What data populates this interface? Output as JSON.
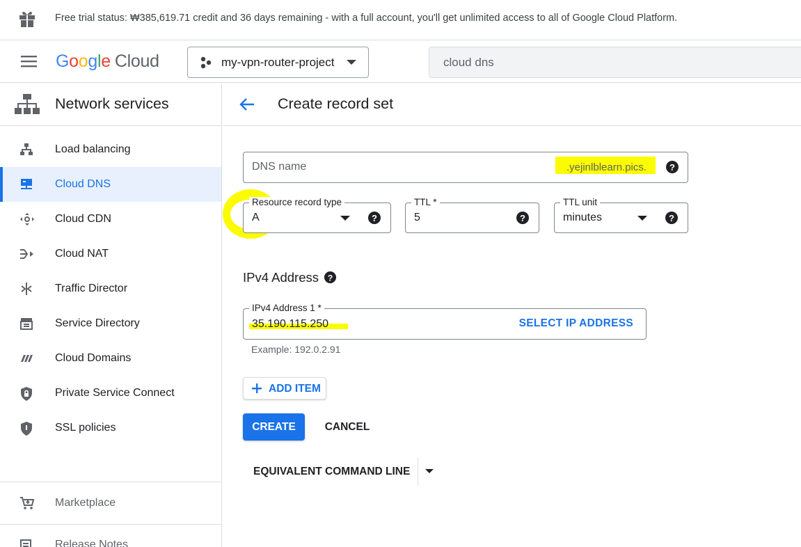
{
  "banner": {
    "text": "Free trial status: ₩385,619.71 credit and 36 days remaining - with a full account, you'll get unlimited access to all of Google Cloud Platform.",
    "icon": "gift-icon"
  },
  "header": {
    "logo": {
      "g1": "G",
      "g2": "o",
      "g3": "o",
      "g4": "g",
      "g5": "l",
      "g6": "e",
      "product": "Cloud"
    },
    "project_name": "my-vpn-router-project",
    "search_value": "cloud dns"
  },
  "sidebar": {
    "title": "Network services",
    "items": [
      {
        "label": "Load balancing",
        "icon": "load-balancing-icon"
      },
      {
        "label": "Cloud DNS",
        "icon": "cloud-dns-icon",
        "active": true
      },
      {
        "label": "Cloud CDN",
        "icon": "cloud-cdn-icon"
      },
      {
        "label": "Cloud NAT",
        "icon": "cloud-nat-icon"
      },
      {
        "label": "Traffic Director",
        "icon": "traffic-director-icon"
      },
      {
        "label": "Service Directory",
        "icon": "service-directory-icon"
      },
      {
        "label": "Cloud Domains",
        "icon": "cloud-domains-icon"
      },
      {
        "label": "Private Service Connect",
        "icon": "shield-lock-icon"
      },
      {
        "label": "SSL policies",
        "icon": "shield-icon"
      }
    ],
    "footer_items": [
      {
        "label": "Marketplace",
        "icon": "cart-icon"
      },
      {
        "label": "Release Notes",
        "icon": "release-notes-icon"
      }
    ]
  },
  "main": {
    "title": "Create record set",
    "dns_name": {
      "placeholder": "DNS name",
      "suffix": ".yejinlblearn.pics."
    },
    "record_type": {
      "label": "Resource record type",
      "value": "A"
    },
    "ttl": {
      "label": "TTL *",
      "value": "5"
    },
    "ttl_unit": {
      "label": "TTL unit",
      "value": "minutes"
    },
    "ipv4_section_title": "IPv4 Address",
    "ipv4_field": {
      "label": "IPv4 Address 1 *",
      "value": "35.190.115.250",
      "action": "SELECT IP ADDRESS"
    },
    "hint": "Example: 192.0.2.91",
    "add_item": "ADD ITEM",
    "create": "CREATE",
    "cancel": "CANCEL",
    "equivalent_command_line": "EQUIVALENT COMMAND LINE"
  },
  "colors": {
    "accent": "#1a73e8",
    "highlight": "#fcfc00",
    "active_bg": "#e8f0fe"
  }
}
